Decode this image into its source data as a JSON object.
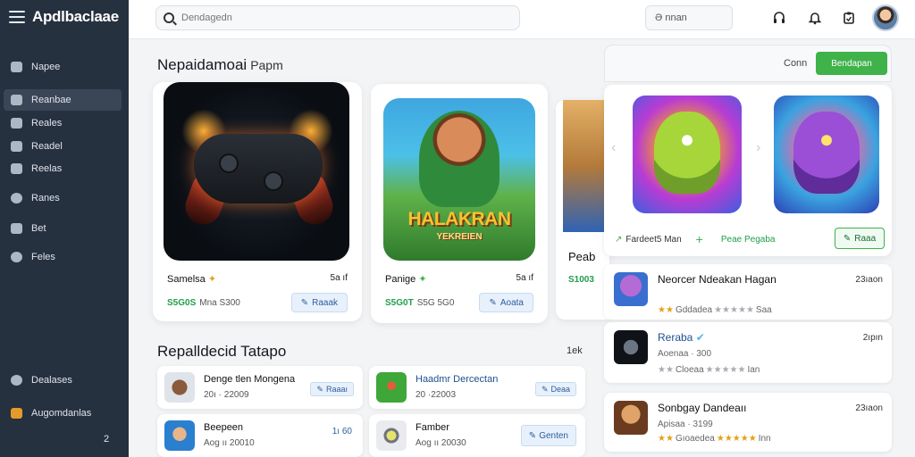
{
  "app": {
    "name": "Apdlbaclaae",
    "search_placeholder": "Dendagedn",
    "small_search": "Ə nnan"
  },
  "colors": {
    "sidebar_bg": "#26313f",
    "accent_green": "#3fb24a",
    "accent_blue": "#2a5e9e"
  },
  "sidebar": {
    "items": [
      {
        "label": "Napee",
        "icon": "home-icon",
        "active": false
      },
      {
        "label": "Reanbae",
        "icon": "library-icon",
        "active": true
      },
      {
        "label": "Reales",
        "icon": "grid-icon",
        "active": false
      },
      {
        "label": "Readel",
        "icon": "puzzle-icon",
        "active": false
      },
      {
        "label": "Reelas",
        "icon": "controller-icon",
        "active": false
      },
      {
        "label": "Ranes",
        "icon": "trophy-icon",
        "active": false
      },
      {
        "label": "Bet",
        "icon": "chart-icon",
        "active": false
      },
      {
        "label": "Feles",
        "icon": "settings-icon",
        "active": false
      }
    ],
    "bottom_items": [
      {
        "label": "Dealases",
        "icon": "support-icon"
      },
      {
        "label": "Augomdanlas",
        "icon": "gift-icon"
      }
    ],
    "badge": "2"
  },
  "main": {
    "featured": {
      "title": "Nepaidamoai",
      "subtitle": "Papm"
    },
    "cards": [
      {
        "name": "Samelsa",
        "rating": "5a ıf",
        "price_green": "S5G0S",
        "price_grey": "Mna S300",
        "button": "Raaak"
      },
      {
        "name": "Panige",
        "rating": "5a ıf",
        "price_green": "S5G0T",
        "price_grey": "S5G 5G0",
        "button": "Aoata",
        "art_title": "HALAKRAN",
        "art_subtitle": "YEKREIEN"
      },
      {
        "name": "Peab",
        "price_green": "S1003"
      }
    ],
    "list_section": {
      "title": "Repalldecid Tatapo",
      "see_all": "1ek"
    },
    "small_items": [
      {
        "title": "Denge tlen Mongena",
        "sub": "20ı · 22009",
        "button": "Raaaı"
      },
      {
        "title": "Haadmr Dercectan",
        "sub": "20 ·22003",
        "button": "Deaa"
      },
      {
        "title": "Beepeen",
        "sub": "Aog ıı 20010",
        "tag": "1ı 60"
      },
      {
        "title": "Famber",
        "sub": "Aog ıı 20030",
        "button": "Genten"
      }
    ]
  },
  "right_panel": {
    "header": {
      "conn": "Conn",
      "button": "Bendapan"
    },
    "featured": {
      "label": "Fardeet5 Man",
      "plus_label": "Peae Pegaba",
      "button": "Raaa"
    },
    "apps": [
      {
        "title": "Neorcer Ndeakan Hagan",
        "time": "23ıaon",
        "sub": "",
        "stars_on": 2,
        "stars_off": 5,
        "stars_text": "Gddadea",
        "stars_tail": "Saa"
      },
      {
        "title": "Reraba",
        "time": "2ıpın",
        "sub": "Aoenaa · 300",
        "stars_on": 0,
        "stars_off": 7,
        "stars_text": "Cloeaa",
        "stars_tail": "Ian"
      },
      {
        "title": "Sonbgay Dandeaıı",
        "time": "23ıaon",
        "sub": "Apisaa · 3199",
        "stars_on": 7,
        "stars_off": 0,
        "stars_text": "Gıoaedea",
        "stars_tail": "Inn"
      }
    ]
  }
}
